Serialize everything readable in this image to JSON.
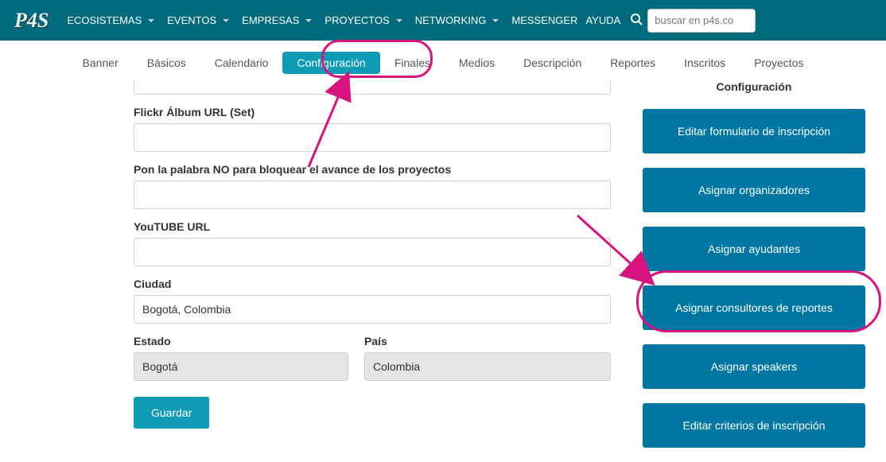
{
  "nav": {
    "logo": "P4S",
    "items": [
      "ECOSISTEMAS",
      "EVENTOS",
      "EMPRESAS",
      "PROYECTOS",
      "NETWORKING"
    ],
    "messenger": "MESSENGER",
    "ayuda": "AYUDA",
    "search_placeholder": "buscar en p4s.co"
  },
  "tabs": {
    "items": [
      "Banner",
      "Básicos",
      "Calendario",
      "Configuración",
      "Finales",
      "Medios",
      "Descripción",
      "Reportes",
      "Inscritos",
      "Proyectos"
    ],
    "active_index": 3
  },
  "form": {
    "flickr_label": "Flickr Álbum URL (Set)",
    "flickr_value": "",
    "noblock_label": "Pon la palabra NO para bloquear el avance de los proyectos",
    "noblock_value": "",
    "youtube_label": "YouTUBE URL",
    "youtube_value": "",
    "ciudad_label": "Ciudad",
    "ciudad_value": "Bogotá, Colombia",
    "estado_label": "Estado",
    "estado_value": "Bogotá",
    "pais_label": "País",
    "pais_value": "Colombia",
    "save_label": "Guardar",
    "top_input_value": ""
  },
  "side": {
    "title": "Configuración",
    "buttons": [
      "Editar formulario de inscripción",
      "Asignar organizadores",
      "Asignar ayudantes",
      "Asignar consultores de reportes",
      "Asignar speakers",
      "Editar criterios de inscripción"
    ]
  },
  "colors": {
    "brand_teal": "#0E9BB6",
    "side_blue": "#0076A3",
    "annotation_pink": "#D8137F"
  }
}
